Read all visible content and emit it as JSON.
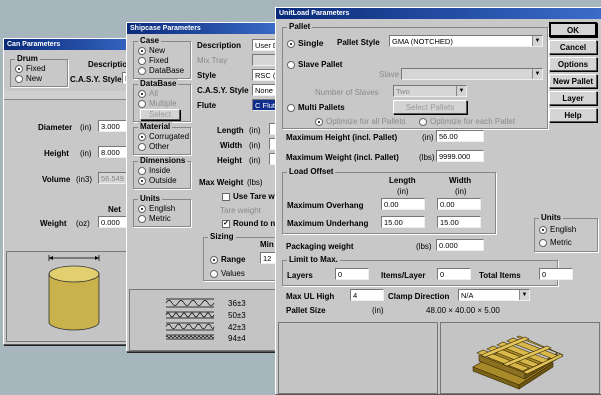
{
  "can": {
    "title": "Can Parameters",
    "drum_label": "Drum",
    "drum_options": [
      "Fixed",
      "New"
    ],
    "description_label": "Description",
    "casy_label": "C.A.S.Y. Style",
    "casy_value": "N",
    "diameter_label": "Diameter",
    "diameter_unit": "(in)",
    "diameter_value": "3.000",
    "height_label": "Height",
    "height_unit": "(in)",
    "height_value": "8.000",
    "volume_label": "Volume",
    "volume_unit": "(in3)",
    "volume_value": "56.549",
    "net_label": "Net",
    "weight_label": "Weight",
    "weight_unit": "(oz)",
    "weight_value": "0.000"
  },
  "ship": {
    "title": "Shipcase Parameters",
    "case_label": "Case",
    "case_options": [
      "New",
      "Fixed",
      "DataBase"
    ],
    "database_label": "DataBase",
    "database_options": [
      "All",
      "Multiple"
    ],
    "select_button": "Select",
    "material_label": "Material",
    "material_options": [
      "Corrugated",
      "Other"
    ],
    "dimensions_label": "Dimensions",
    "dimensions_options": [
      "Inside",
      "Outside"
    ],
    "units_label": "Units",
    "units_options": [
      "English",
      "Metric"
    ],
    "description_label": "Description",
    "description_value": "User D",
    "mixtray_label": "Mix Tray",
    "style_label": "Style",
    "style_value": "RSC (I",
    "casy_label": "C.A.S.Y. Style",
    "casy_value": "None",
    "flute_label": "Flute",
    "flute_value": "C Flute",
    "length_label": "Length",
    "width_label": "Width",
    "height_label": "Height",
    "in_unit": "(in)",
    "maxweight_label": "Max Weight",
    "maxweight_unit": "(lbs)",
    "tare_check": "Use Tare we",
    "tare_weight_label": "Tare weight",
    "round_check": "Round to ne",
    "sizing_label": "Sizing",
    "sizing_min": "Min",
    "sizing_range": "Range",
    "sizing_range_value": "12",
    "sizing_values": "Values",
    "flutes": [
      "36±3",
      "50±3",
      "42±3",
      "94±4"
    ]
  },
  "unit": {
    "title": "UnitLoad Parameters",
    "pallet_label": "Pallet",
    "single_label": "Single",
    "pallet_style_label": "Pallet Style",
    "pallet_style_value": "GMA (NOTCHED)",
    "slave_pallet_label": "Slave Pallet",
    "slave_label": "Slave",
    "number_slaves_label": "Number of Slaves",
    "number_slaves_value": "Two",
    "multi_label": "Multi Pallets",
    "select_pallets_button": "Select Pallets",
    "optimize_all": "Optimize for all Pallets",
    "optimize_each": "Optimize for each Pallet",
    "max_height_label": "Maximum Height (incl. Pallet)",
    "max_height_unit": "(in)",
    "max_height_value": "56.00",
    "max_weight_label": "Maximum Weight (incl. Pallet)",
    "max_weight_unit": "(lbs)",
    "max_weight_value": "9999.000",
    "load_offset_label": "Load Offset",
    "length_hdr": "Length",
    "width_hdr": "Width",
    "in_unit": "(in)",
    "overhang_label": "Maximum Overhang",
    "overhang_length": "0.00",
    "overhang_width": "0.00",
    "underhang_label": "Maximum Underhang",
    "underhang_length": "15.00",
    "underhang_width": "15.00",
    "packaging_label": "Packaging weight",
    "packaging_unit": "(lbs)",
    "packaging_value": "0.000",
    "limit_label": "Limit to Max.",
    "layers_label": "Layers",
    "layers_value": "0",
    "items_layer_label": "Items/Layer",
    "items_layer_value": "0",
    "total_items_label": "Total Items",
    "total_items_value": "0",
    "maxul_label": "Max UL High",
    "maxul_value": "4",
    "clamp_label": "Clamp Direction",
    "clamp_value": "N/A",
    "pallet_size_label": "Pallet Size",
    "pallet_size_unit": "(in)",
    "pallet_size_value": "48.00 × 40.00 × 5.00",
    "units_label": "Units",
    "units_options": [
      "English",
      "Metric"
    ],
    "buttons": {
      "ok": "OK",
      "cancel": "Cancel",
      "options": "Options",
      "new_pallet": "New Pallet",
      "layer": "Layer",
      "help": "Help"
    }
  }
}
